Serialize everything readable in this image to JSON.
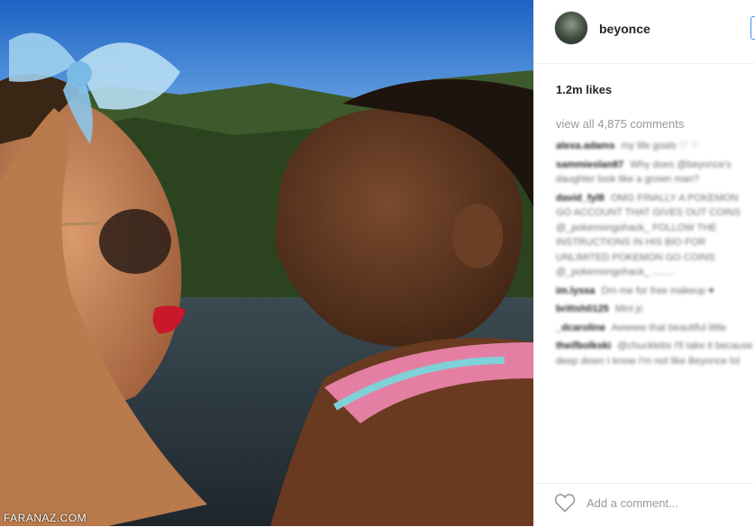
{
  "post": {
    "username": "beyonce",
    "likes": "1.2m likes",
    "view_all": "view all 4,875 comments",
    "add_comment_placeholder": "Add a comment...",
    "watermark": "FARANAZ.COM"
  },
  "comments": [
    {
      "user": "alexa.adams",
      "text": "my life goals ♡ ♡"
    },
    {
      "user": "sammieslan87",
      "text": "Why does @beyonce's daughter look like a grown man?"
    },
    {
      "user": "david_fyl8",
      "text": "OMG FINALLY A POKEMON GO ACCOUNT THAT GIVES OUT COINS @_pokemongohack_ FOLLOW THE INSTRUCTIONS IN HIS BIO FOR UNLIMITED POKEMON GO COINS @_pokemongohack_ ........"
    },
    {
      "user": "im.lyssa",
      "text": "Dm me for free makeup ♥"
    },
    {
      "user": "brittsh0125",
      "text": "Mini jc"
    },
    {
      "user": "_dcaroline",
      "text": "Awwww that beautiful little"
    },
    {
      "user": "theifbolkski",
      "text": "@chucklebs I'll take it because deep down I know I'm not like Beyonce lol"
    }
  ],
  "colors": {
    "accent": "#3897f0",
    "text": "#262626",
    "muted": "#999999"
  },
  "icons": {
    "like": "heart-outline-icon"
  }
}
